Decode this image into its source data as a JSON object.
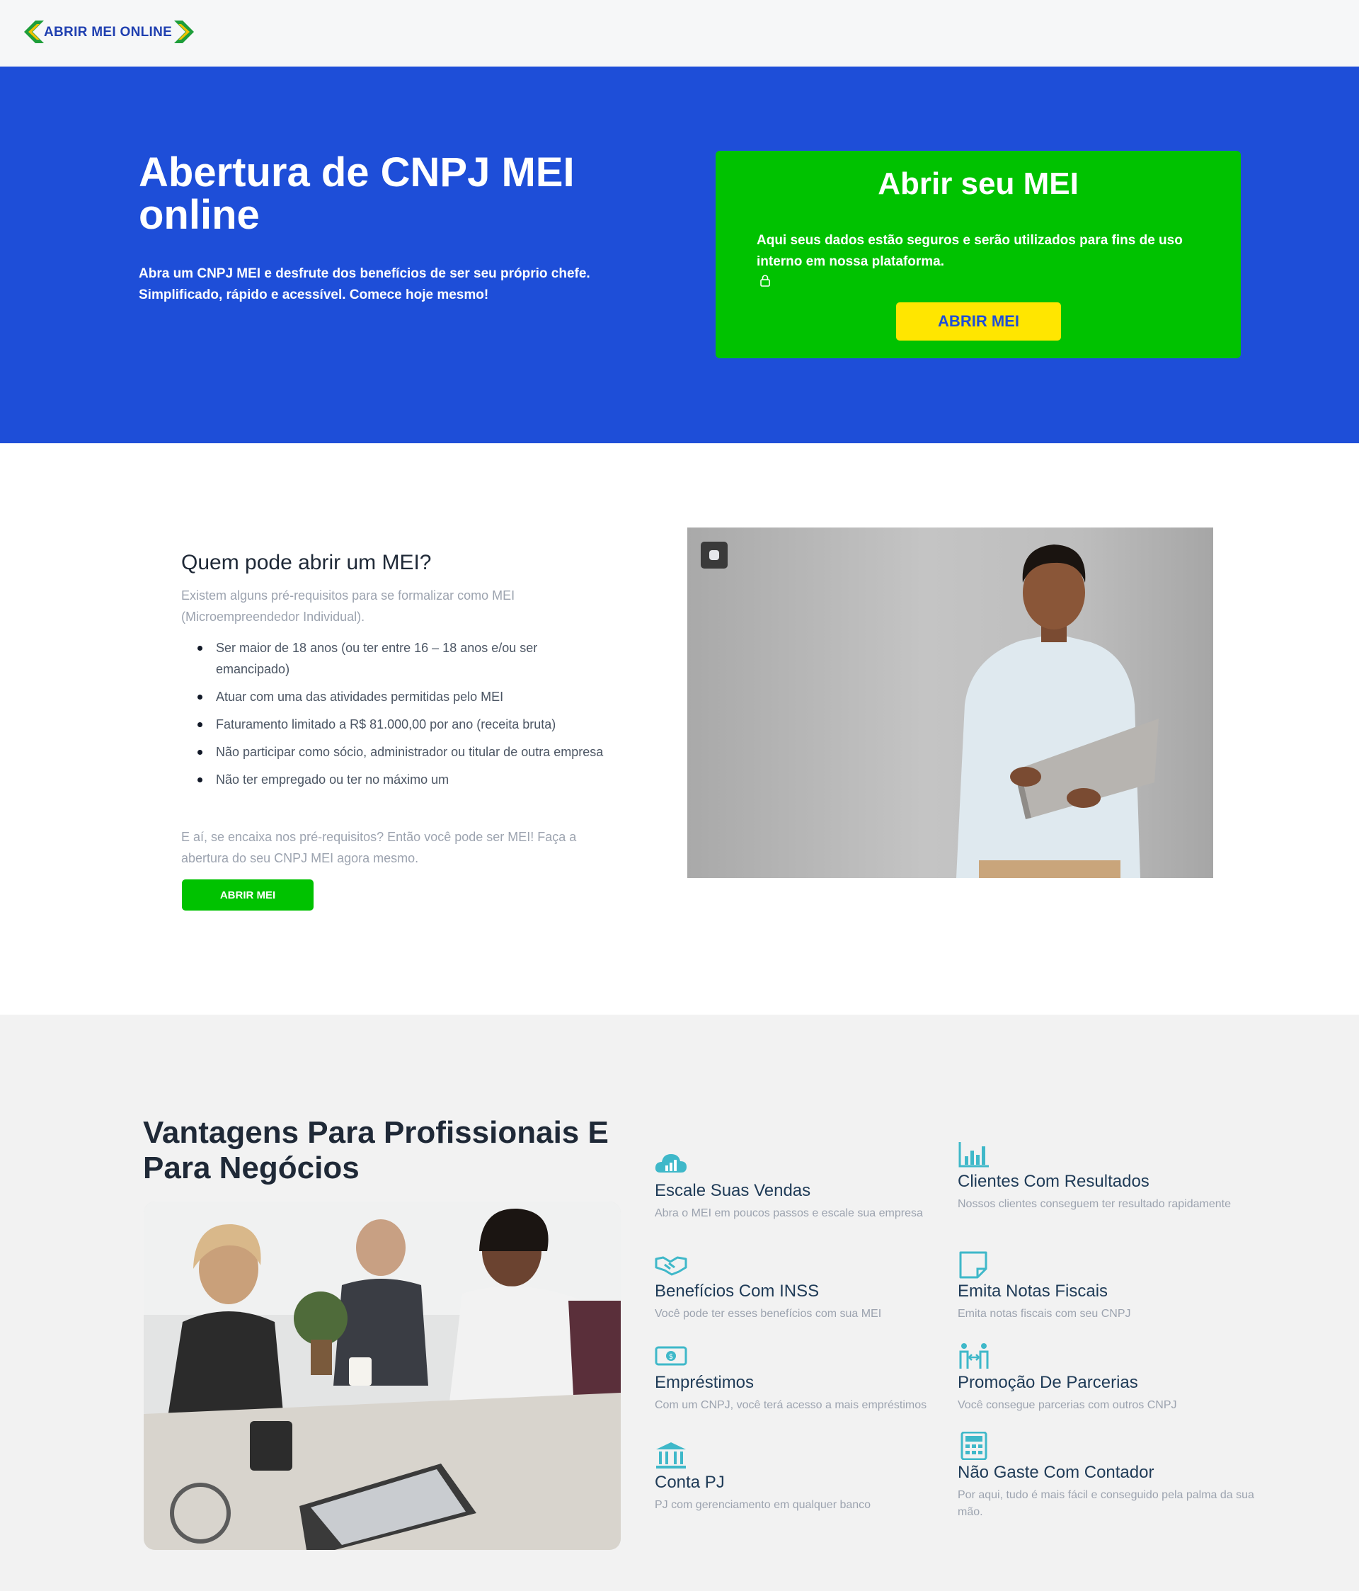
{
  "header": {
    "logo_text": "ABRIR MEI ONLINE"
  },
  "hero": {
    "title": "Abertura de CNPJ MEI online",
    "subtitle": "Abra um CNPJ MEI e desfrute dos benefícios de ser seu próprio chefe. Simplificado, rápido e acessível. Comece hoje mesmo!",
    "card": {
      "title": "Abrir seu MEI",
      "text": "Aqui seus dados estão seguros e serão utilizados para fins de uso interno em nossa plataforma.",
      "button_label": "ABRIR MEI"
    }
  },
  "who": {
    "title": "Quem pode abrir um MEI?",
    "intro": "Existem alguns pré-requisitos para se formalizar como MEI (Microempreendedor Individual).",
    "requirements": [
      "Ser maior de 18 anos (ou ter entre 16 – 18 anos e/ou ser emancipado)",
      "Atuar com uma das atividades permitidas pelo MEI",
      "Faturamento limitado a R$ 81.000,00 por ano (receita bruta)",
      "Não participar como sócio, administrador ou titular de outra empresa",
      "Não ter empregado ou ter no máximo um"
    ],
    "outro": "E aí, se encaixa nos pré-requisitos? Então você pode ser MEI! Faça a abertura do seu CNPJ MEI agora mesmo.",
    "button_label": "ABRIR MEI"
  },
  "advantages": {
    "title": "Vantagens Para Profissionais E Para Negócios",
    "features": [
      {
        "icon": "cloud-chart-icon",
        "title": "Escale Suas Vendas",
        "desc": "Abra o MEI em poucos passos e escale sua empresa"
      },
      {
        "icon": "bar-chart-icon",
        "title": "Clientes Com Resultados",
        "desc": "Nossos clientes conseguem ter resultado rapidamente"
      },
      {
        "icon": "handshake-icon",
        "title": "Benefícios Com INSS",
        "desc": "Você pode ter esses benefícios com sua MEI"
      },
      {
        "icon": "note-icon",
        "title": "Emita Notas Fiscais",
        "desc": "Emita notas fiscais com seu CNPJ"
      },
      {
        "icon": "money-icon",
        "title": "Empréstimos",
        "desc": "Com um CNPJ, você terá acesso a mais empréstimos"
      },
      {
        "icon": "people-icon",
        "title": "Promoção De Parcerias",
        "desc": "Você consegue parcerias com outros CNPJ"
      },
      {
        "icon": "bank-icon",
        "title": "Conta PJ",
        "desc": "PJ com gerenciamento em qualquer banco"
      },
      {
        "icon": "calculator-icon",
        "title": "Não Gaste Com Contador",
        "desc": "Por aqui, tudo é mais fácil e conseguido pela palma da sua mão."
      }
    ]
  },
  "colors": {
    "hero_blue": "#1e4ed8",
    "green": "#00c200",
    "yellow": "#ffe600",
    "icon_teal": "#3fb8c9"
  }
}
